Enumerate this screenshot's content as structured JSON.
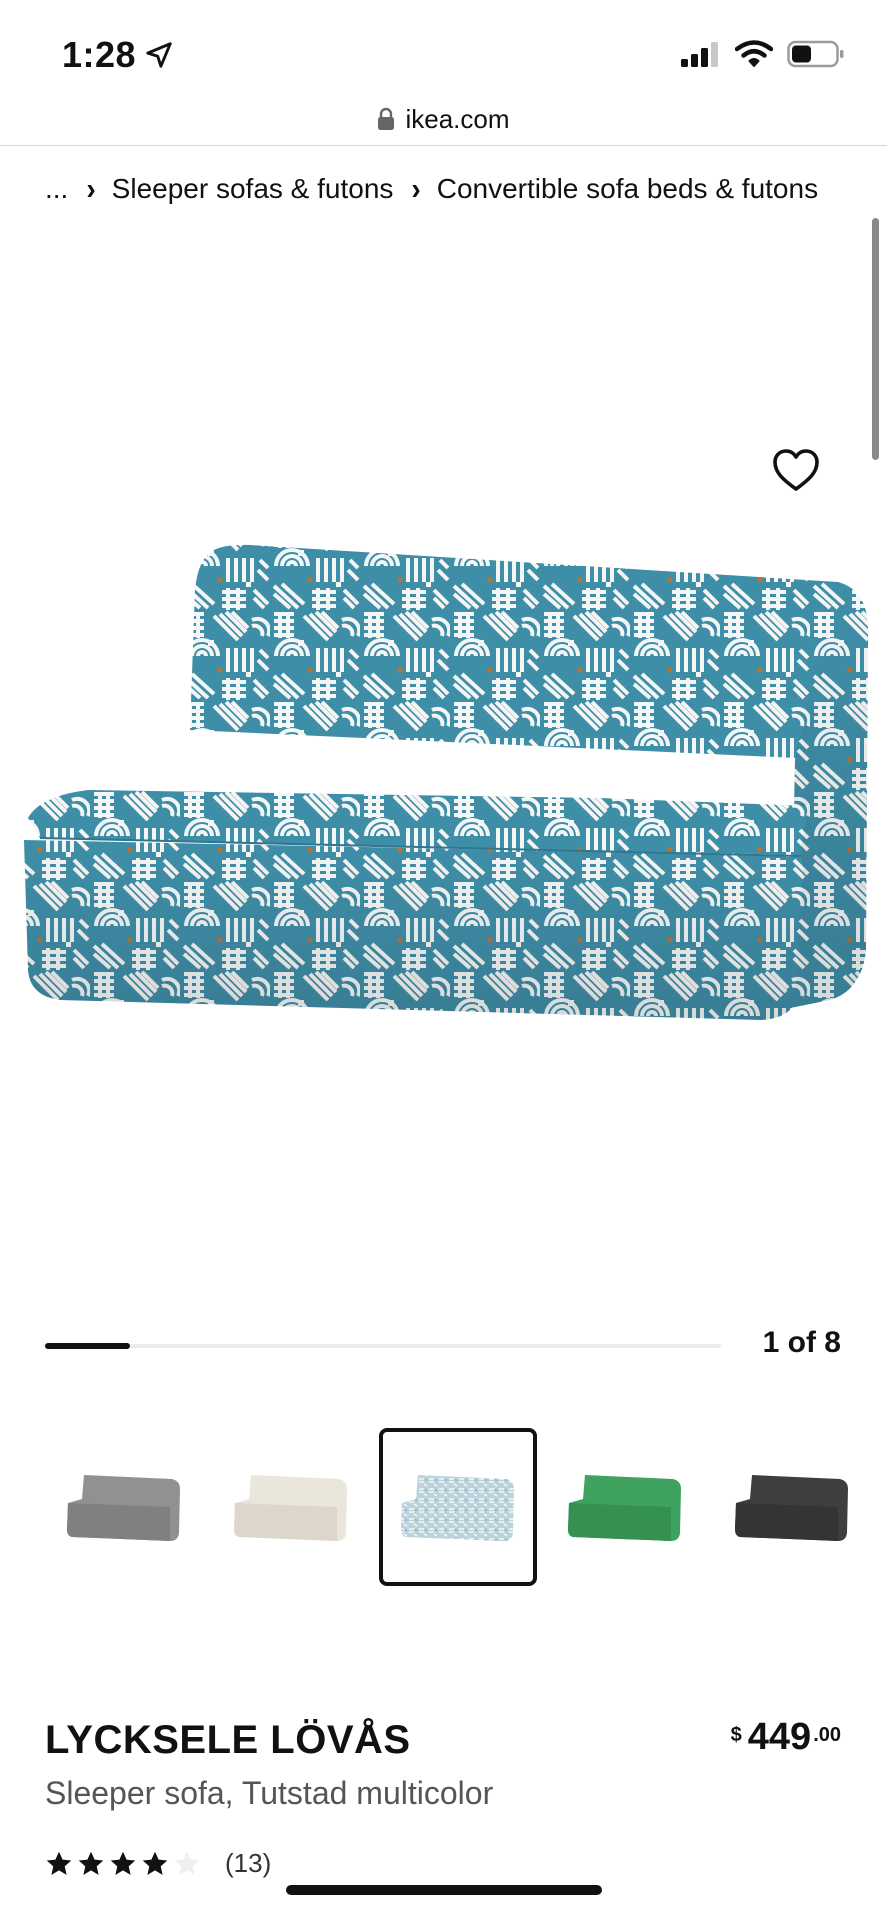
{
  "status_bar": {
    "time": "1:28",
    "location_icon": "location-arrow-icon",
    "signal_icon": "cellular-signal-icon",
    "wifi_icon": "wifi-icon",
    "battery_icon": "battery-icon",
    "battery_level": 0.45
  },
  "browser": {
    "lock_icon": "lock-icon",
    "url": "ikea.com"
  },
  "breadcrumb": {
    "items": [
      "...",
      "Sleeper sofas & futons",
      "Convertible sofa beds & futons"
    ],
    "separator": "›"
  },
  "gallery": {
    "favorite_icon": "heart-outline-icon",
    "current_image": 1,
    "total_images": 8,
    "counter_text": "1 of 8",
    "progress": 0.125
  },
  "variants": [
    {
      "name": "gray",
      "color": "#8f9192",
      "selected": false
    },
    {
      "name": "beige",
      "color": "#e7e2d8",
      "selected": false
    },
    {
      "name": "tutstad multicolor",
      "color": "#5e9db4",
      "selected": true
    },
    {
      "name": "green",
      "color": "#3fa25f",
      "selected": false
    },
    {
      "name": "dark gray",
      "color": "#3c3e40",
      "selected": false
    }
  ],
  "product": {
    "name": "LYCKSELE LÖVÅS",
    "description": "Sleeper sofa, Tutstad multicolor",
    "price": {
      "currency": "$",
      "whole": "449",
      "cents": ".00"
    },
    "rating": 4,
    "rating_max": 5,
    "review_count": "(13)"
  },
  "colors": {
    "accent": "#111111",
    "fabric_blue": "#3f8ea8",
    "fabric_white": "#f4f6f6"
  }
}
